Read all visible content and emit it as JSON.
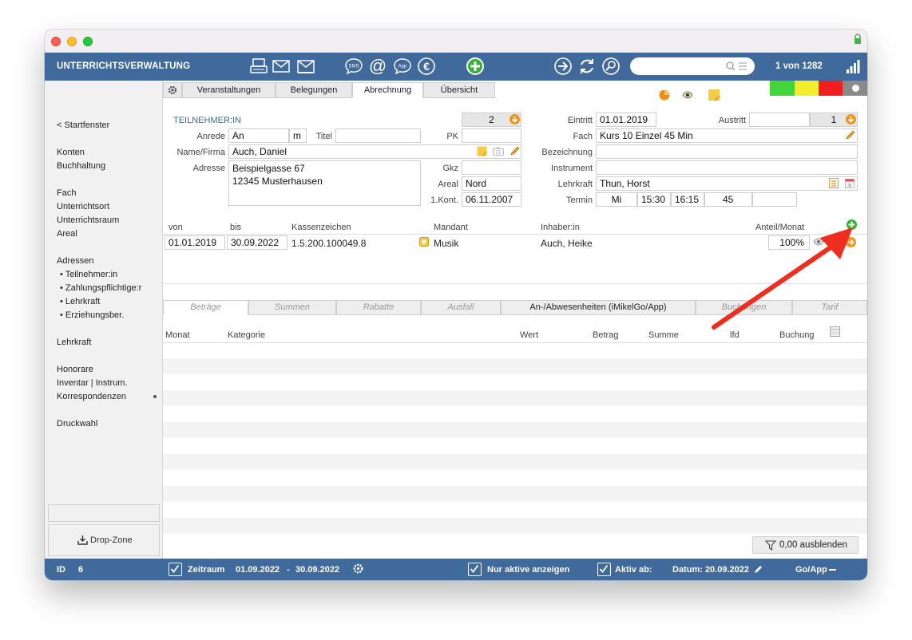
{
  "app_title": "UNTERRICHTSVERWALTUNG",
  "record_count": "1 von 1282",
  "search": {
    "placeholder": ""
  },
  "toolbar_icons": [
    "printer-icon",
    "mail-icon",
    "letter-icon",
    "sms-icon",
    "at-icon",
    "app-icon",
    "euro-icon",
    "add-record-icon",
    "next-arrow-icon",
    "refresh-icon",
    "search-icon",
    "signal-icon"
  ],
  "sidebar": {
    "back": "< Startfenster",
    "group1": [
      "Konten",
      "Buchhaltung"
    ],
    "group2": [
      "Fach",
      "Unterrichtsort",
      "Unterrichtsraum",
      "Areal"
    ],
    "adressen": "Adressen",
    "adressen_sub": [
      "• Teilnehmer:in",
      "• Zahlungspflichtige:r",
      "• Lehrkraft",
      "• Erziehungsber."
    ],
    "lehrkraft": "Lehrkraft",
    "group3": [
      "Honorare",
      "Inventar | Instrum.",
      "Korrespondenzen"
    ],
    "druckwahl": "Druckwahl",
    "drop_zone": "Drop-Zone"
  },
  "tabs": [
    "Veranstaltungen",
    "Belegungen",
    "Abrechnung",
    "Übersicht"
  ],
  "active_tab": "Abrechnung",
  "status_colors": [
    "#44d53a",
    "#f3ee2b",
    "#f01e1e",
    "#8a8a8a"
  ],
  "form": {
    "section_title": "TEILNEHMER:IN",
    "count_value": "2",
    "anrede_label": "Anrede",
    "anrede_value": "An",
    "anrede_gender": "m",
    "titel_label": "Titel",
    "titel_value": "",
    "pk_label": "PK",
    "pk_value": "",
    "name_label": "Name/Firma",
    "name_value": "Auch, Daniel",
    "adresse_label": "Adresse",
    "adresse_line1": "Beispielgasse 67",
    "adresse_line2": "12345 Musterhausen",
    "gkz_label": "Gkz",
    "gkz_value": "",
    "areal_label": "Areal",
    "areal_value": "Nord",
    "kont_label": "1.Kont.",
    "kont_value": "06.11.2007",
    "eintritt_label": "Eintritt",
    "eintritt_value": "01.01.2019",
    "austritt_label": "Austritt",
    "austritt_value": "",
    "austritt_count": "1",
    "fach_label": "Fach",
    "fach_value": "Kurs 10 Einzel 45 Min",
    "bezeichnung_label": "Bezeichnung",
    "bezeichnung_value": "",
    "instrument_label": "Instrument",
    "instrument_value": "",
    "lehrkraft_label": "Lehrkraft",
    "lehrkraft_value": "Thun, Horst",
    "termin_label": "Termin",
    "termin_day": "Mi",
    "termin_from": "15:30",
    "termin_to": "16:15",
    "termin_duration": "45",
    "termin_extra": ""
  },
  "payer_table": {
    "headers": [
      "von",
      "bis",
      "Kassenzeichen",
      "Mandant",
      "Inhaber:in",
      "Anteil/Monat"
    ],
    "rows": [
      {
        "von": "01.01.2019",
        "bis": "30.09.2022",
        "kassenzeichen": "1.5.200.100049.8",
        "mandant": "Musik",
        "inhaber": "Auch, Heike",
        "anteil": "100%"
      }
    ]
  },
  "bottom_tabs": [
    "Beträge",
    "Summen",
    "Rabatte",
    "Ausfall",
    "An-/Abwesenheiten (iMikelGo/App)",
    "Buchungen",
    "Tarif"
  ],
  "amounts_table": {
    "headers": [
      "Monat",
      "Kategorie",
      "Wert",
      "Betrag",
      "Summe",
      "lfd",
      "Buchung"
    ]
  },
  "hide_zero_button": "0,00 ausblenden",
  "statusbar": {
    "id_label": "ID",
    "id_value": "6",
    "zeitraum_label": "Zeitraum",
    "zeitraum_from": "01.09.2022",
    "zeitraum_sep": "-",
    "zeitraum_to": "30.09.2022",
    "nur_aktive": "Nur aktive anzeigen",
    "aktiv_ab": "Aktiv ab:",
    "datum": "Datum: 20.09.2022",
    "goapp": "Go/App"
  }
}
